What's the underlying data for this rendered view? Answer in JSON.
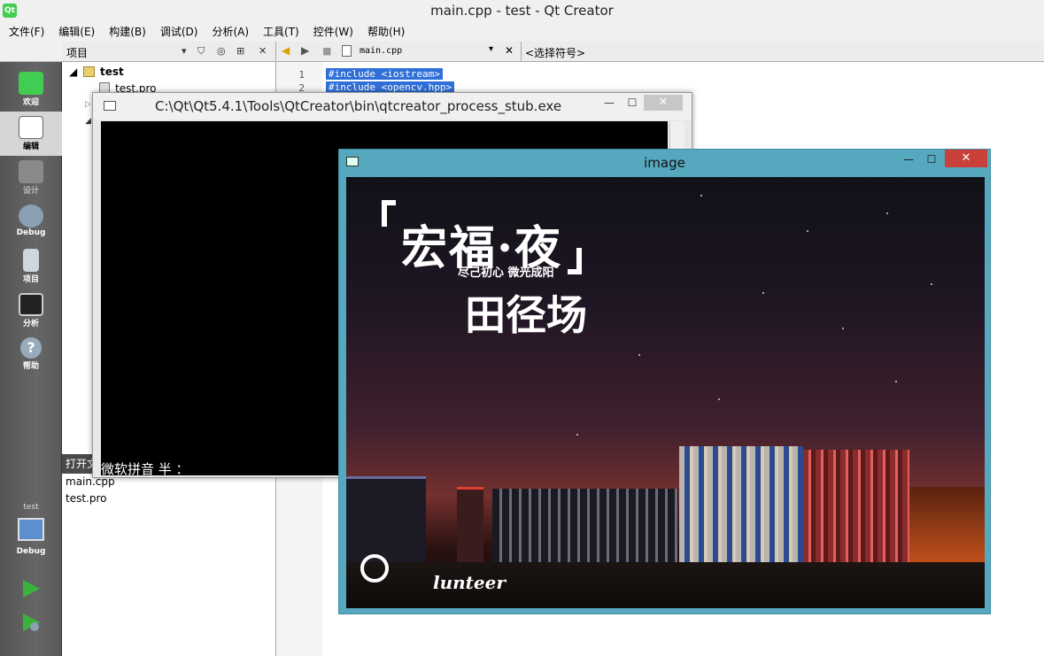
{
  "window": {
    "title": "main.cpp - test - Qt Creator",
    "icon_label": "Qt"
  },
  "menu": [
    "文件(F)",
    "编辑(E)",
    "构建(B)",
    "调试(D)",
    "分析(A)",
    "工具(T)",
    "控件(W)",
    "帮助(H)"
  ],
  "modes": [
    {
      "label": "欢迎",
      "icon": "qt-logo-icon"
    },
    {
      "label": "编辑",
      "icon": "document-edit-icon"
    },
    {
      "label": "设计",
      "icon": "design-pen-icon"
    },
    {
      "label": "Debug",
      "icon": "debug-bug-icon"
    },
    {
      "label": "项目",
      "icon": "project-folder-icon"
    },
    {
      "label": "分析",
      "icon": "analyze-chart-icon"
    },
    {
      "label": "帮助",
      "icon": "help-icon"
    }
  ],
  "kit": {
    "project": "test",
    "label": "Debug"
  },
  "projects_panel": {
    "title": "项目",
    "tree": [
      {
        "label": "test",
        "bold": true
      },
      {
        "label": "test.pro",
        "bold": false
      }
    ]
  },
  "open_docs": {
    "header": "打开文",
    "items": [
      "main.cpp",
      "test.pro"
    ]
  },
  "editor_header": {
    "file": "main.cpp",
    "symbol": "<选择符号>"
  },
  "code_lines": [
    {
      "num": "1",
      "text": "#include <iostream>"
    },
    {
      "num": "2",
      "text": "#include <opencv.hpp>"
    }
  ],
  "console_window": {
    "title": "C:\\Qt\\Qt5.4.1\\Tools\\QtCreator\\bin\\qtcreator_process_stub.exe",
    "ime_text": "微软拼音 半 ："
  },
  "image_window": {
    "title": "image",
    "poster": {
      "title": "宏福·夜",
      "subtitle": "尽己初心 微光成阳",
      "place": "田径场",
      "logo_text": "lunteer"
    }
  },
  "colors": {
    "accent": "#2f6fd8",
    "image_window_frame": "#55a8be",
    "close_button": "#c9403a",
    "run_green": "#3bb33b"
  }
}
